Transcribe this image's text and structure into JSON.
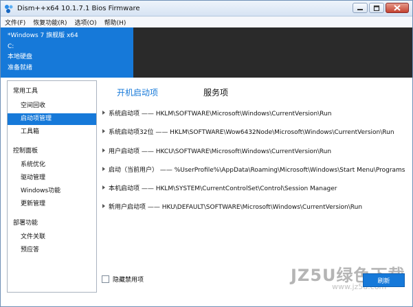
{
  "window": {
    "title": "Dism++x64 10.1.7.1 Bios Firmware"
  },
  "menu": [
    {
      "label": "文件(F)"
    },
    {
      "label": "恢复功能(R)"
    },
    {
      "label": "选项(O)"
    },
    {
      "label": "帮助(H)"
    }
  ],
  "system_info": {
    "os": "*Windows 7 旗舰版 x64",
    "drive": "C:",
    "disk": "本地硬盘",
    "status": "准备就绪"
  },
  "sidebar": {
    "groups": [
      {
        "label": "常用工具",
        "items": [
          {
            "label": "空间回收"
          },
          {
            "label": "启动项管理",
            "active": true
          },
          {
            "label": "工具箱"
          }
        ]
      },
      {
        "label": "控制面板",
        "items": [
          {
            "label": "系统优化"
          },
          {
            "label": "驱动管理"
          },
          {
            "label": "Windows功能"
          },
          {
            "label": "更新管理"
          }
        ]
      },
      {
        "label": "部署功能",
        "items": [
          {
            "label": "文件关联"
          },
          {
            "label": "预应答"
          }
        ]
      }
    ]
  },
  "tabs": [
    {
      "label": "开机启动项",
      "active": true
    },
    {
      "label": "服务项",
      "active": false
    }
  ],
  "startup_entries": [
    {
      "label": "系统启动项 —— HKLM\\SOFTWARE\\Microsoft\\Windows\\CurrentVersion\\Run"
    },
    {
      "label": "系统启动项32位 —— HKLM\\SOFTWARE\\Wow6432Node\\Microsoft\\Windows\\CurrentVersion\\Run"
    },
    {
      "label": "用户启动项 —— HKCU\\SOFTWARE\\Microsoft\\Windows\\CurrentVersion\\Run"
    },
    {
      "label": "启动（当前用户） —— %UserProfile%\\AppData\\Roaming\\Microsoft\\Windows\\Start Menu\\Programs"
    },
    {
      "label": "本机启动项 —— HKLM\\SYSTEM\\CurrentControlSet\\Control\\Session Manager"
    },
    {
      "label": "新用户启动项 —— HKU\\DEFAULT\\SOFTWARE\\Microsoft\\Windows\\CurrentVersion\\Run"
    }
  ],
  "bottom": {
    "hide_disabled_label": "隐藏禁用项",
    "refresh_label": "刷新"
  },
  "watermark": {
    "text": "JZ5U绿色下载",
    "sub": "www.jz5u.com"
  },
  "colors": {
    "accent": "#1679d9",
    "dark_panel": "#2a2a2a"
  }
}
